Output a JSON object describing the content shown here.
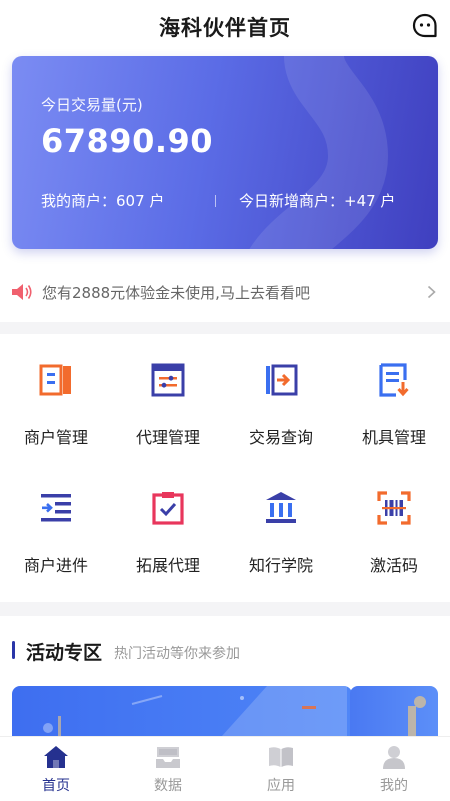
{
  "header": {
    "title": "海科伙伴首页"
  },
  "hero": {
    "label": "今日交易量(元)",
    "amount": "67890.90",
    "merchants_label": "我的商户：607 户",
    "new_merchants_label": "今日新增商户：+47 户"
  },
  "notice": {
    "text": "您有2888元体验金未使用,马上去看看吧"
  },
  "grid": {
    "items": [
      {
        "label": "商户管理",
        "icon": "merchant-management-icon"
      },
      {
        "label": "代理管理",
        "icon": "agent-management-icon"
      },
      {
        "label": "交易查询",
        "icon": "transaction-query-icon"
      },
      {
        "label": "机具管理",
        "icon": "device-management-icon"
      },
      {
        "label": "商户进件",
        "icon": "merchant-onboarding-icon"
      },
      {
        "label": "拓展代理",
        "icon": "expand-agent-icon"
      },
      {
        "label": "知行学院",
        "icon": "academy-icon"
      },
      {
        "label": "激活码",
        "icon": "activation-code-icon"
      }
    ]
  },
  "section": {
    "title": "活动专区",
    "subtitle": "热门活动等你来参加"
  },
  "tabbar": {
    "items": [
      {
        "label": "首页",
        "icon": "home-icon",
        "active": true
      },
      {
        "label": "数据",
        "icon": "data-icon",
        "active": false
      },
      {
        "label": "应用",
        "icon": "apps-icon",
        "active": false
      },
      {
        "label": "我的",
        "icon": "profile-icon",
        "active": false
      }
    ]
  },
  "colors": {
    "primary": "#25318f",
    "accent_orange": "#f26b2d",
    "accent_blue": "#3a6ff0",
    "accent_red": "#e8365c"
  }
}
